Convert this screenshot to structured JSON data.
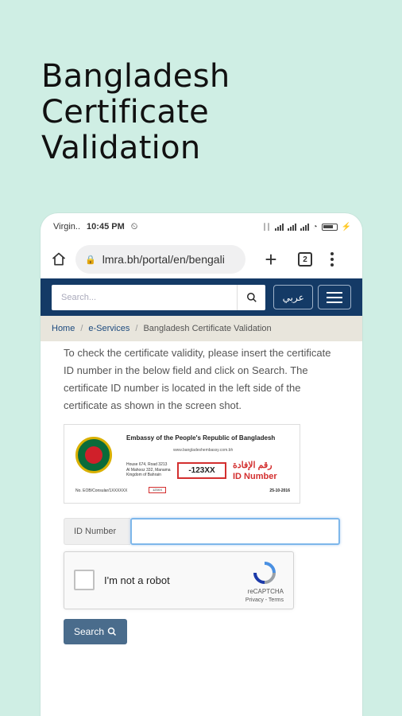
{
  "headline": {
    "line1": "Bangladesh",
    "line2": "Certificate",
    "line3": "Validation"
  },
  "status_bar": {
    "carrier": "Virgin..",
    "time": "10:45 PM",
    "battery_text": "",
    "icons": [
      "alarm-icon",
      "signal-icon",
      "wifi-icon",
      "battery-icon"
    ]
  },
  "browser": {
    "url": "lmra.bh/portal/en/bengali",
    "tab_count": "2"
  },
  "site_header": {
    "search_placeholder": "Search...",
    "language_button": "عربي",
    "colors": {
      "header_bg": "#143a66"
    }
  },
  "breadcrumb": {
    "home": "Home",
    "services": "e-Services",
    "current": "Bangladesh Certificate Validation"
  },
  "main": {
    "intro": "To check the certificate validity, please insert the certificate ID number in the below field and click on Search. The certificate ID number is located in the left side of the certificate as shown in the screen shot.",
    "certificate_image": {
      "embassy": "Embassy of the People's Republic of Bangladesh",
      "website": "www.bangladeshembassy.com.bh",
      "address": "House 674, Road 3213\nAl Mahooz 332, Manama\nKingdom of Bahrain",
      "id_sample": "123XX",
      "arabic_label": "رقم الإفادة",
      "id_label": "ID Number",
      "reference": "No. EOB/Consular/1XXXXXX",
      "small_box": "123XX",
      "date": "25-10-2016"
    },
    "id_label": "ID Number",
    "id_value": "",
    "captcha": {
      "label": "I'm not a robot",
      "brand": "reCAPTCHA",
      "terms": "Privacy - Terms"
    },
    "search_button": "Search"
  }
}
